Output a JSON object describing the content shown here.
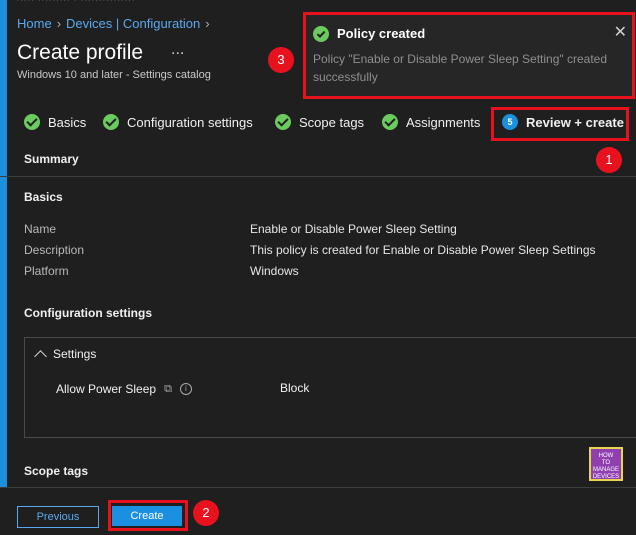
{
  "header": {
    "breadcrumb": [
      "Home",
      "Devices | Configuration"
    ],
    "title": "Create profile",
    "more_label": "...",
    "subtitle": "Windows 10 and later - Settings catalog"
  },
  "toast": {
    "title": "Policy created",
    "message": "Policy \"Enable or Disable Power Sleep Setting\" created successfully",
    "close_glyph": "✕"
  },
  "tabs": [
    {
      "label": "Basics",
      "done": true
    },
    {
      "label": "Configuration settings",
      "done": true
    },
    {
      "label": "Scope tags",
      "done": true
    },
    {
      "label": "Assignments",
      "done": true
    },
    {
      "label": "Review + create",
      "step": "5",
      "active": true
    }
  ],
  "summary": {
    "heading": "Summary",
    "basics_heading": "Basics",
    "rows": [
      {
        "label": "Name",
        "value": "Enable or Disable Power Sleep Setting"
      },
      {
        "label": "Description",
        "value": "This policy is created for Enable or Disable Power Sleep Settings"
      },
      {
        "label": "Platform",
        "value": "Windows"
      }
    ],
    "config_heading": "Configuration settings",
    "settings_group": "Settings",
    "setting": {
      "name": "Allow Power Sleep",
      "value": "Block"
    },
    "scope_heading": "Scope tags"
  },
  "footer": {
    "previous_label": "Previous",
    "create_label": "Create"
  },
  "annotations": [
    "1",
    "2",
    "3"
  ],
  "logo_text": "HOW TO MANAGE DEVICES",
  "colors": {
    "accent": "#1b8fe0",
    "success": "#6ccb5f",
    "highlight": "#e8121f",
    "background": "#1f1f1f"
  }
}
